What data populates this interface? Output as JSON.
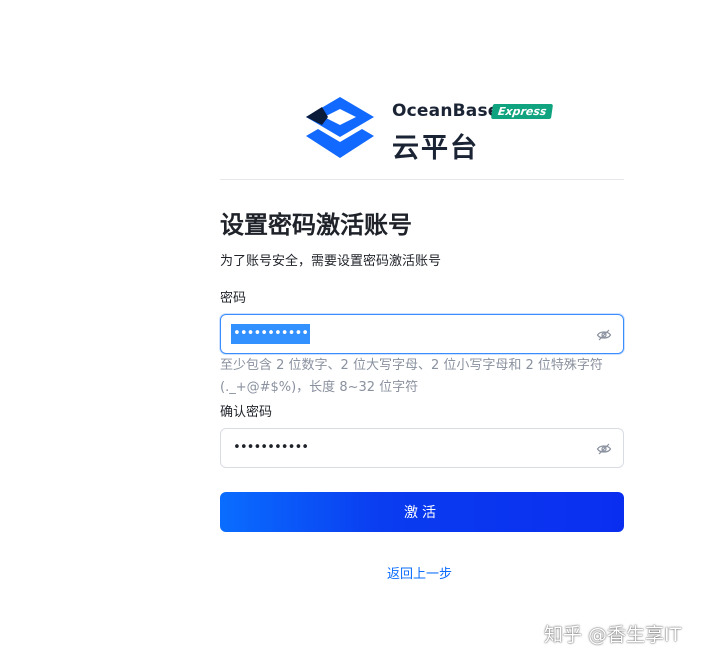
{
  "brand": {
    "name": "OceanBase",
    "badge": "Express",
    "subtitle": "云平台",
    "colors": {
      "primary": "#1269ff",
      "dark": "#0b1c3a",
      "badge": "#10a37f"
    }
  },
  "form": {
    "title": "设置密码激活账号",
    "subtitle": "为了账号安全，需要设置密码激活账号",
    "password": {
      "label": "密码",
      "value": "•••••••••••",
      "selected": true,
      "hint": "至少包含 2 位数字、2 位大写字母、2 位小写字母和 2 位特殊字符(._+@#$%)，长度 8~32 位字符",
      "toggle_icon": "eye-hidden-icon"
    },
    "confirm_password": {
      "label": "确认密码",
      "value": "•••••••••••",
      "toggle_icon": "eye-hidden-icon"
    },
    "submit_label": "激活",
    "back_link": "返回上一步"
  },
  "watermark": "知乎 @香生享IT",
  "theme": {
    "accent": "#0a4cff",
    "link": "#0a6cff",
    "hint_text": "#8a919f"
  }
}
